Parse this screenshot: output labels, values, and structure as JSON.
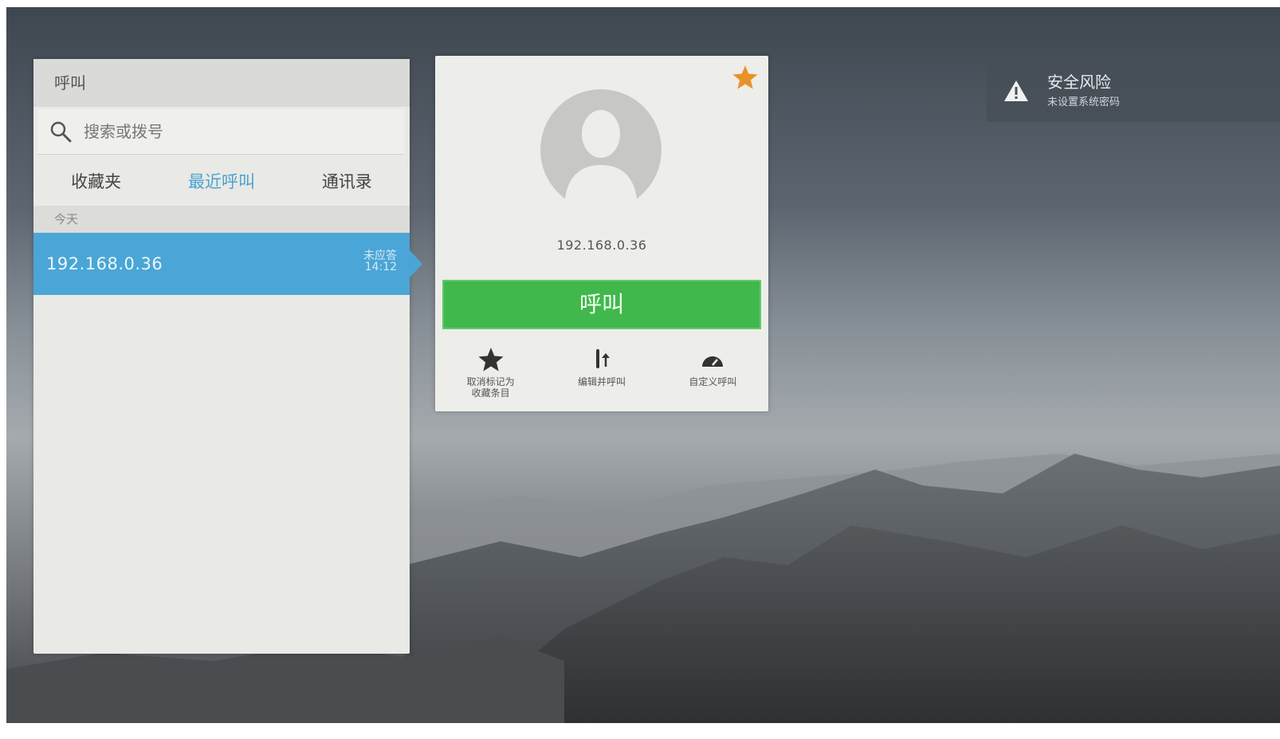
{
  "call_panel": {
    "title": "呼叫",
    "search": {
      "placeholder": "搜索或拨号",
      "icon": "search-icon"
    },
    "tabs": [
      {
        "label": "收藏夹",
        "active": false
      },
      {
        "label": "最近呼叫",
        "active": true
      },
      {
        "label": "通讯录",
        "active": false
      }
    ],
    "section_label": "今天",
    "recent_calls": [
      {
        "address": "192.168.0.36",
        "status": "未应答",
        "time": "14:12"
      }
    ]
  },
  "detail": {
    "address": "192.168.0.36",
    "favorite": true,
    "call_label": "呼叫",
    "actions": [
      {
        "icon": "star-icon",
        "label_line1": "取消标记为",
        "label_line2": "收藏条目"
      },
      {
        "icon": "edit-call-icon",
        "label_line1": "编辑并呼叫",
        "label_line2": ""
      },
      {
        "icon": "custom-call-icon",
        "label_line1": "自定义呼叫",
        "label_line2": ""
      }
    ]
  },
  "security_notice": {
    "title": "安全风险",
    "subtitle": "未设置系统密码",
    "icon": "warning-icon"
  },
  "colors": {
    "accent_blue": "#4aa6d6",
    "call_green": "#40b84c",
    "favorite_orange": "#e8922a"
  }
}
